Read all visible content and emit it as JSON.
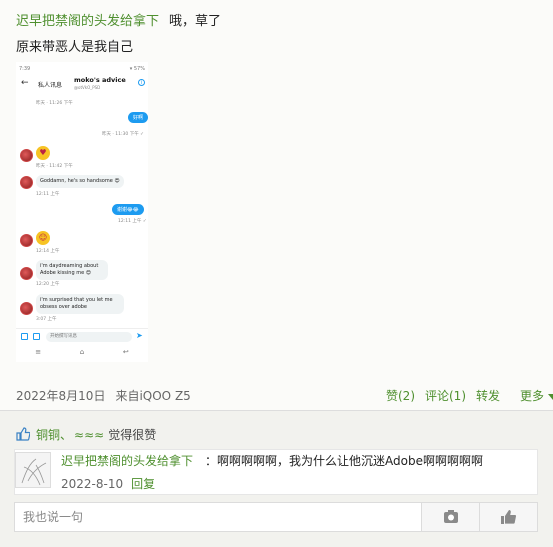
{
  "post": {
    "author": "迟早把禁阁的头发给拿下",
    "line1_text": "哦，草了",
    "line2_text": "原来带恶人是我自己",
    "date": "2022年8月10日",
    "source": "来自iQOO Z5",
    "actions": {
      "like": "赞(2)",
      "comment": "评论(1)",
      "repost": "转发",
      "more": "更多"
    }
  },
  "screenshot": {
    "status_time": "7:39",
    "status_right": "▾ 57%",
    "header_title": "私人讯息",
    "username": "moko's advice",
    "handle": "@otVkO_PSD",
    "messages": {
      "t0": "昨天 · 11:26 下午",
      "out1": "好啊",
      "t1": "昨天 · 11:30 下午 ✓",
      "t2": "昨天 · 11:42 下午",
      "in1": "Goddamn, he's so handsome 😍",
      "t3": "12:11 上午",
      "out2": "谢谢😂😂",
      "t4": "12:11 上午 ✓",
      "t5": "12:14 上午",
      "in2": "i'm daydreaming about Adobe kissing me 😍",
      "t6": "12:20 上午",
      "in3": "i'm surprised that you let me obsess over adobe",
      "t7": "3:07 上午"
    },
    "compose_placeholder": "开始撰写讯息"
  },
  "likes": {
    "names": "铜铜、",
    "names2": "≈≈≈",
    "text": "觉得很赞"
  },
  "comment": {
    "author": "迟早把禁阁的头发给拿下",
    "text": "：啊啊啊啊啊，我为什么让他沉迷Adobe啊啊啊啊啊",
    "date": "2022-8-10",
    "reply": "回复"
  },
  "reply_bar": {
    "placeholder": "我也说一句"
  },
  "colors": {
    "link": "#4e8f2e",
    "twitter_blue": "#1d9bf0"
  }
}
